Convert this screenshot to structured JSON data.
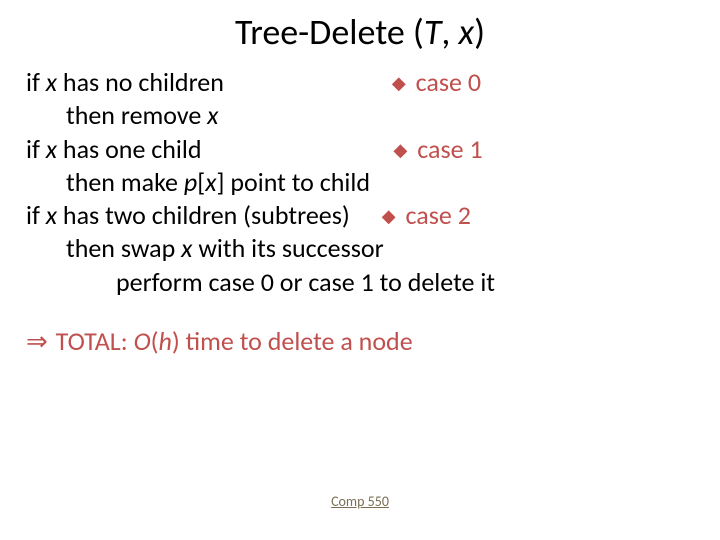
{
  "title_pre": "Tree-Delete (",
  "title_t": "T",
  "title_sep": ", ",
  "title_x": "x",
  "title_post": ")",
  "l1a": "if ",
  "l1b": "x",
  "l1c": " has no children",
  "case0": " case 0",
  "l2a": "then remove ",
  "l2b": "x",
  "l3a": "if ",
  "l3b": "x",
  "l3c": " has one child",
  "case1": " case 1",
  "l4a": "then make ",
  "l4b": "p",
  "l4c": "[",
  "l4d": "x",
  "l4e": "] point to child",
  "l5a": "if ",
  "l5b": "x",
  "l5c": " has two children (subtrees)",
  "case2": " case 2",
  "l6a": "then swap ",
  "l6b": "x",
  "l6c": " with its successor",
  "l7": "perform case 0 or case 1 to delete it",
  "total_pre": " TOTAL: ",
  "total_o": "O",
  "total_paren1": "(",
  "total_h": "h",
  "total_paren2": ") time to delete a node",
  "footer": "Comp 550",
  "diamond": "◆",
  "arrow": "⇒"
}
